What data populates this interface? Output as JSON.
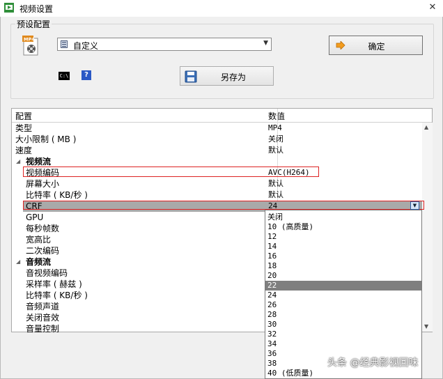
{
  "window": {
    "title": "视频设置",
    "close_glyph": "✕"
  },
  "preset": {
    "group_label": "预设配置",
    "format_icon": "mp4-file-icon",
    "format_badge": "MP4",
    "combo_value": "自定义",
    "ok_label": "确定",
    "save_as_label": "另存为",
    "cmd_glyph": "C:\\",
    "help_glyph": "?"
  },
  "grid": {
    "col_key": "配置",
    "col_value": "数值",
    "rows": [
      {
        "k": "类型",
        "v": "MP4",
        "kind": "plain"
      },
      {
        "k": "大小限制 ( MB )",
        "v": "关闭",
        "kind": "plain"
      },
      {
        "k": "速度",
        "v": "默认",
        "kind": "plain"
      },
      {
        "k": "视频流",
        "v": "",
        "kind": "sect"
      },
      {
        "k": "视频编码",
        "v": "AVC(H264)",
        "kind": "indent"
      },
      {
        "k": "屏幕大小",
        "v": "默认",
        "kind": "indent"
      },
      {
        "k": "比特率 ( KB/秒 )",
        "v": "默认",
        "kind": "indent"
      },
      {
        "k": "CRF",
        "v": "24",
        "kind": "sel"
      },
      {
        "k": "GPU",
        "v": "",
        "kind": "indent"
      },
      {
        "k": "每秒帧数",
        "v": "",
        "kind": "indent"
      },
      {
        "k": "宽高比",
        "v": "",
        "kind": "indent"
      },
      {
        "k": "二次编码",
        "v": "",
        "kind": "indent"
      },
      {
        "k": "音频流",
        "v": "",
        "kind": "sect"
      },
      {
        "k": "音视频编码",
        "v": "",
        "kind": "indent"
      },
      {
        "k": "采样率 ( 赫兹 )",
        "v": "",
        "kind": "indent"
      },
      {
        "k": "比特率 ( KB/秒 )",
        "v": "",
        "kind": "indent"
      },
      {
        "k": "音频声道",
        "v": "",
        "kind": "indent"
      },
      {
        "k": "关闭音效",
        "v": "",
        "kind": "indent"
      },
      {
        "k": "音量控制",
        "v": "",
        "kind": "indent"
      }
    ]
  },
  "crf_dropdown": {
    "items": [
      "关闭",
      "10 (高质量)",
      "12",
      "14",
      "16",
      "18",
      "20",
      "22",
      "24",
      "26",
      "28",
      "30",
      "32",
      "34",
      "36",
      "38",
      "40 (低质量)"
    ],
    "selected": "22"
  },
  "watermark": "头条 @经典影视回味",
  "colors": {
    "highlight_border": "#dd2222",
    "selected_row": "#a9a9a9",
    "dropdown_selected": "#7f7f7f"
  }
}
